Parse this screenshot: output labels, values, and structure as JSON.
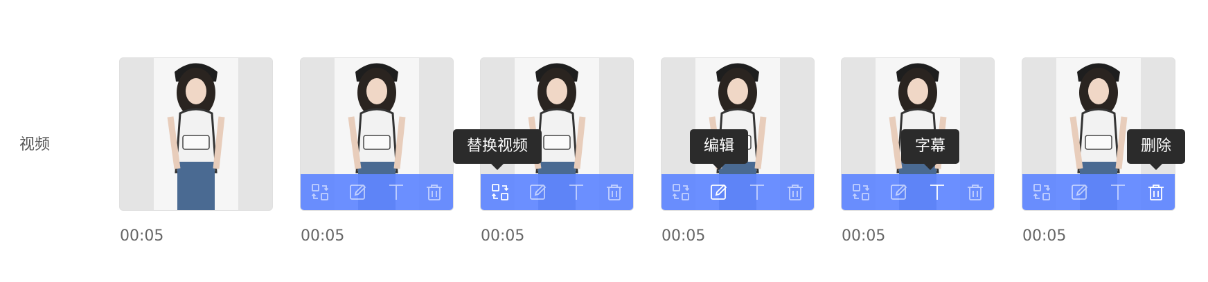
{
  "row": {
    "label": "视频"
  },
  "clips": [
    {
      "duration": "00:05"
    },
    {
      "duration": "00:05"
    },
    {
      "duration": "00:05"
    },
    {
      "duration": "00:05"
    },
    {
      "duration": "00:05"
    },
    {
      "duration": "00:05"
    }
  ],
  "tooltips": {
    "replace": "替换视频",
    "edit": "编辑",
    "subtitle": "字幕",
    "delete": "删除"
  },
  "colors": {
    "toolbar": "#6086ff",
    "tooltip": "#2b2b2b",
    "label": "#555555"
  },
  "icons": {
    "replace": "replace-icon",
    "edit": "edit-icon",
    "subtitle": "text-icon",
    "delete": "trash-icon"
  }
}
